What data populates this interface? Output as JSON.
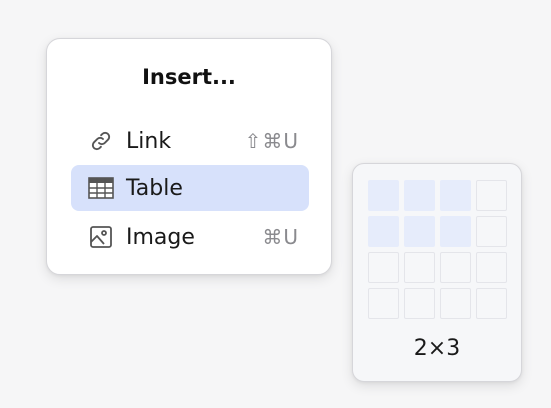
{
  "menu": {
    "title": "Insert...",
    "items": [
      {
        "label": "Link",
        "icon": "link-icon",
        "shortcut": "⇧⌘U",
        "selected": false
      },
      {
        "label": "Table",
        "icon": "table-icon",
        "shortcut": "",
        "selected": true
      },
      {
        "label": "Image",
        "icon": "image-icon",
        "shortcut": "⌘U",
        "selected": false
      }
    ]
  },
  "table_picker": {
    "rows_total": 4,
    "cols_total": 4,
    "selected_rows": 2,
    "selected_cols": 3,
    "size_label": "2×3"
  },
  "colors": {
    "selected_bg": "#d7e1fb",
    "cell_on": "#e6ecfb"
  }
}
